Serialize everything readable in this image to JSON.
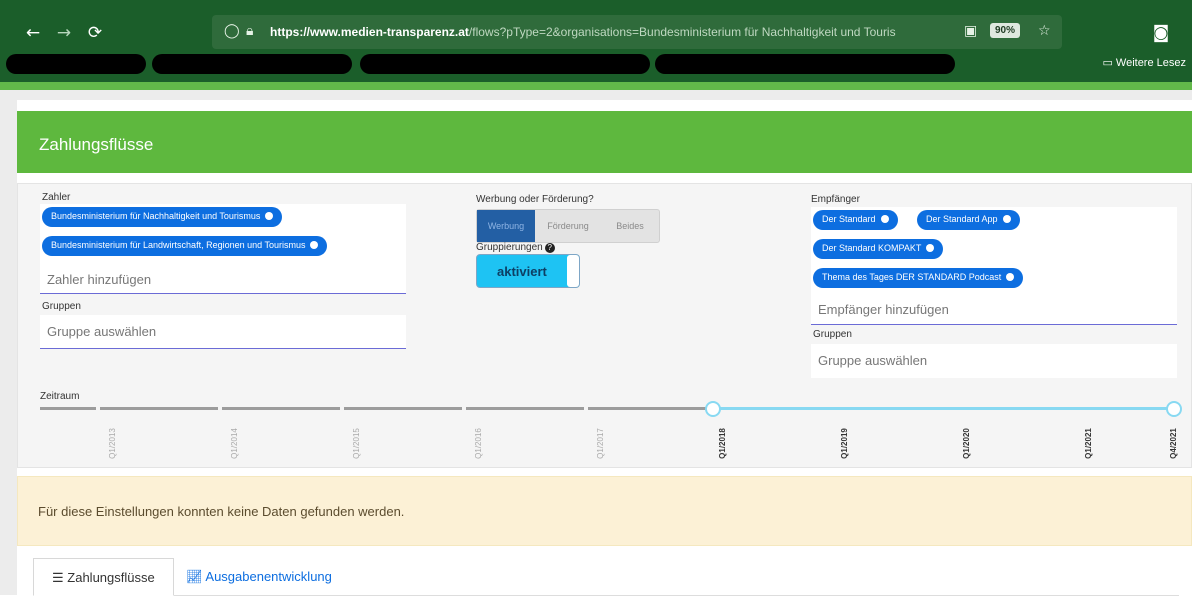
{
  "browser": {
    "back_icon": "←",
    "forward_icon": "→",
    "reload_icon": "⟳",
    "url_host": "https://www.medien-transparenz.at",
    "url_path": "/flows?pType=2&organisations=Bundesministerium für Nachhaltigkeit und Touris",
    "zoom": "90%",
    "bookmark_label": "Weitere Lesez"
  },
  "header": {
    "title": "Zahlungsflüsse"
  },
  "filters": {
    "zahler": {
      "label": "Zahler",
      "chips": [
        "Bundesministerium für Nachhaltigkeit und Tourismus",
        "Bundesministerium für Landwirtschaft, Regionen und Tourismus"
      ],
      "placeholder": "Zahler hinzufügen"
    },
    "gruppen_left": {
      "label": "Gruppen",
      "placeholder": "Gruppe auswählen"
    },
    "werbung": {
      "label": "Werbung oder Förderung?",
      "options": [
        "Werbung",
        "Förderung",
        "Beides"
      ],
      "selected": "Werbung"
    },
    "gruppierungen": {
      "label": "Gruppierungen",
      "switch_label": "aktiviert"
    },
    "empfaenger": {
      "label": "Empfänger",
      "chips": [
        "Der Standard",
        "Der Standard App",
        "Der Standard KOMPAKT",
        "Thema des Tages DER STANDARD Podcast"
      ],
      "placeholder": "Empfänger hinzufügen"
    },
    "gruppen_right": {
      "label": "Gruppen",
      "placeholder": "Gruppe auswählen"
    },
    "zeitraum": {
      "label": "Zeitraum",
      "ticks": [
        "Q1/2013",
        "Q1/2014",
        "Q1/2015",
        "Q1/2016",
        "Q1/2017",
        "Q1/2018",
        "Q1/2019",
        "Q1/2020",
        "Q1/2021",
        "Q4/2021"
      ],
      "selected_from": "Q1/2018",
      "selected_to": "Q4/2021"
    }
  },
  "notice": {
    "text": "Für diese Einstellungen konnten keine Daten gefunden werden."
  },
  "tabs": [
    {
      "label": "Zahlungsflüsse",
      "icon": "list-icon"
    },
    {
      "label": "Ausgabenentwicklung",
      "icon": "chart-icon"
    }
  ],
  "colors": {
    "header": "#5eb83e",
    "chip": "#0d6ee0",
    "switch": "#1ec3f3",
    "notice": "#fcf1d6",
    "timeline_active": "#88d9f2"
  }
}
